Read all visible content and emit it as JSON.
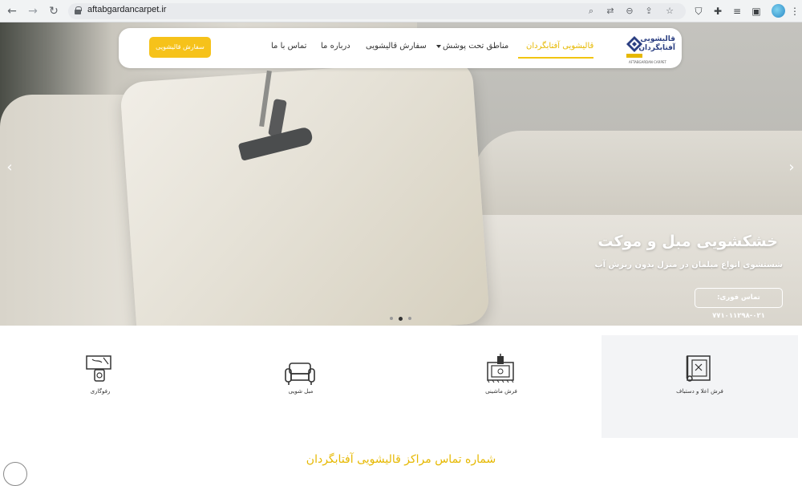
{
  "browser": {
    "url": "aftabgardancarpet.ir"
  },
  "navbar": {
    "logo_text_line1": "قالیشویی",
    "logo_text_line2": "آفتابگردان",
    "logo_subtitle": "AFTABGARDAN CARPET",
    "menu": [
      {
        "label": "قالیشویی آفتابگردان",
        "active": true
      },
      {
        "label": "مناطق تحت پوشش",
        "active": false
      },
      {
        "label": "سفارش قالیشویی",
        "active": false
      },
      {
        "label": "درباره ما",
        "active": false
      },
      {
        "label": "تماس با ما",
        "active": false
      }
    ],
    "order_button": "سفارش قالیشویی"
  },
  "hero": {
    "title": "خشکشویی مبل و موکت",
    "subtitle": "شستشوی انواع مبلمان در منزل بدون ریزش آب",
    "cta": "تماس فوری: ۰۲۱-۷۷۱۰۱۱۲۹۸",
    "slides": 3,
    "active_slide": 2
  },
  "services": [
    {
      "label": "فرش اعلا و دستباف",
      "icon": "handmade-carpet-icon"
    },
    {
      "label": "فرش ماشینی",
      "icon": "machine-carpet-icon"
    },
    {
      "label": "مبل شویی",
      "icon": "sofa-icon"
    },
    {
      "label": "رفوگاری",
      "icon": "carpet-repair-icon"
    }
  ],
  "contact_title": "شماره تماس مراکز قالیشویی آفتابگردان",
  "colors": {
    "accent": "#f2c511",
    "active_menu": "#e6b800"
  }
}
